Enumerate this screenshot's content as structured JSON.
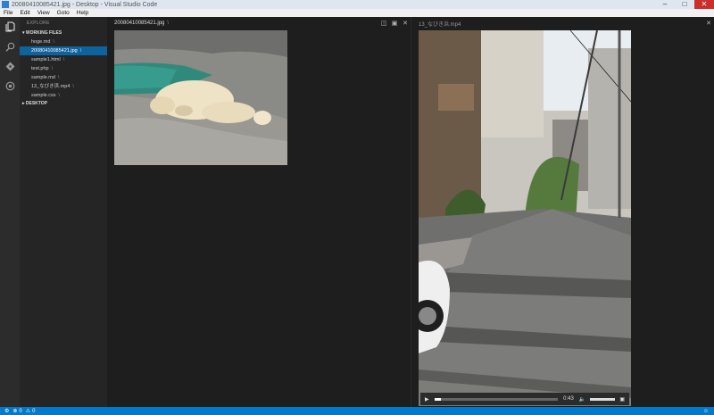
{
  "window": {
    "title": "20080410085421.jpg - Desktop - Visual Studio Code"
  },
  "menu": [
    "File",
    "Edit",
    "View",
    "Goto",
    "Help"
  ],
  "sidebar": {
    "header": "EXPLORE",
    "working_files_label": "WORKING FILES",
    "desktop_label": "DESKTOP",
    "files": [
      {
        "name": "hoge.md",
        "dir": "\\"
      },
      {
        "name": "20080410085421.jpg",
        "dir": "\\"
      },
      {
        "name": "sample1.html",
        "dir": "\\"
      },
      {
        "name": "test.php",
        "dir": "\\"
      },
      {
        "name": "sample.md",
        "dir": "\\"
      },
      {
        "name": "13_なびき浜.mp4",
        "dir": "\\"
      },
      {
        "name": "sample.css",
        "dir": "\\"
      }
    ],
    "active_index": 1
  },
  "editor_left": {
    "filename": "20080410085421.jpg",
    "dir": "\\"
  },
  "editor_right": {
    "filename": "13_なびき浜.mp4"
  },
  "video": {
    "time": "0:43",
    "progress": 0.05,
    "volume": 1.0
  },
  "status": {
    "errors": "0",
    "warnings": "0"
  },
  "colors": {
    "accent": "#007acc",
    "selection": "#0e639c"
  }
}
